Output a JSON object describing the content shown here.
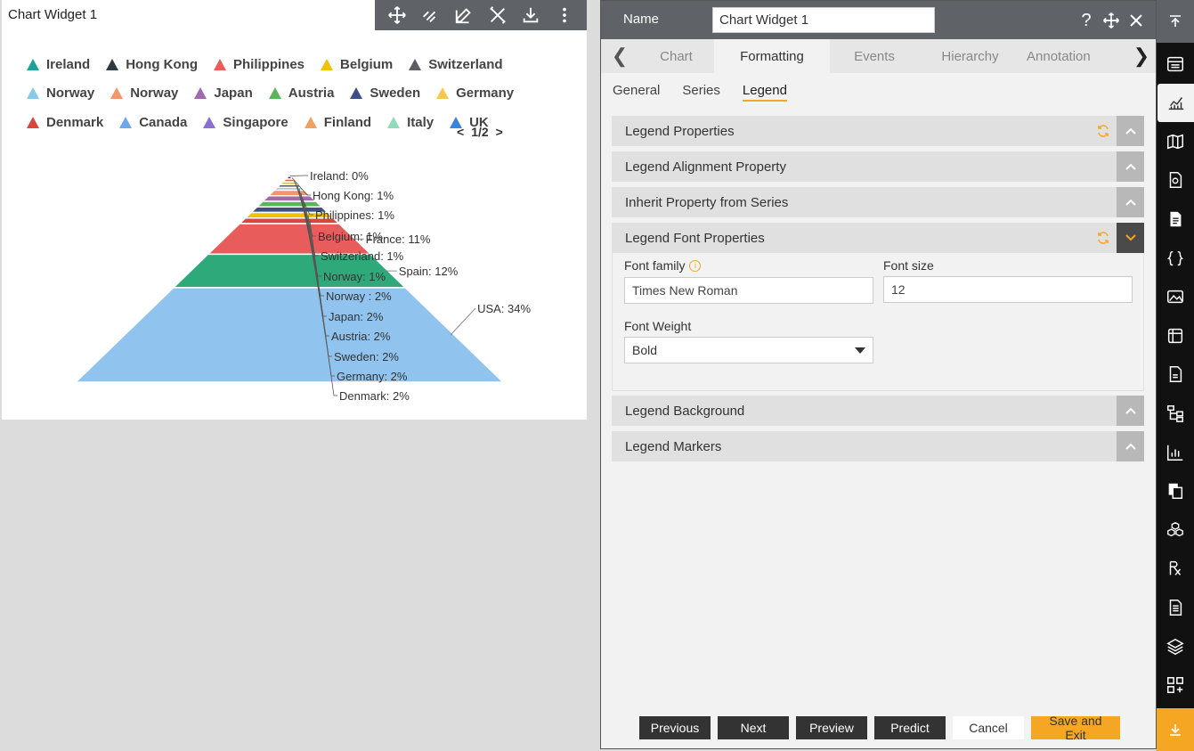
{
  "widget": {
    "title": "Chart Widget 1",
    "toolbar_icons": [
      "move-icon",
      "link-icon",
      "edit-icon",
      "tools-icon",
      "download-icon",
      "more-icon"
    ]
  },
  "chart_data": {
    "type": "pyramid",
    "legend": {
      "rows": [
        [
          {
            "name": "Ireland",
            "color": "#1aa39a"
          },
          {
            "name": "Hong Kong",
            "color": "#2f3a40"
          },
          {
            "name": "Philippines",
            "color": "#e85c5c"
          },
          {
            "name": "Belgium",
            "color": "#f2c200"
          },
          {
            "name": "Switzerland",
            "color": "#5a5e63"
          }
        ],
        [
          {
            "name": "Norway",
            "color": "#89c9e8"
          },
          {
            "name": "Norway",
            "color": "#f5956b"
          },
          {
            "name": "Japan",
            "color": "#a06aad"
          },
          {
            "name": "Austria",
            "color": "#5bb55b"
          },
          {
            "name": "Sweden",
            "color": "#3d4f8a"
          },
          {
            "name": "Germany",
            "color": "#f5c84b"
          }
        ],
        [
          {
            "name": "Denmark",
            "color": "#d9463e"
          },
          {
            "name": "Canada",
            "color": "#6fa8e8"
          },
          {
            "name": "Singapore",
            "color": "#8a6ed0"
          },
          {
            "name": "Finland",
            "color": "#f0a060"
          },
          {
            "name": "Italy",
            "color": "#8fdbbe"
          },
          {
            "name": "UK",
            "color": "#3a84d9"
          }
        ]
      ],
      "pager": "1/2",
      "pager_prev": "<",
      "pager_next": ">"
    },
    "slices": [
      {
        "label": "Ireland: 0%",
        "value": 0,
        "color": "#1aa39a"
      },
      {
        "label": "Hong Kong: 1%",
        "value": 1,
        "color": "#2f3a40"
      },
      {
        "label": "Philippines: 1%",
        "value": 1,
        "color": "#e85c5c"
      },
      {
        "label": "Belgium: 1%",
        "value": 1,
        "color": "#f2c200"
      },
      {
        "label": "Switzerland: 1%",
        "value": 1,
        "color": "#5a5e63"
      },
      {
        "label": "Norway: 1%",
        "value": 1,
        "color": "#89c9e8"
      },
      {
        "label": "Norway : 2%",
        "value": 2,
        "color": "#f5956b"
      },
      {
        "label": "Japan: 2%",
        "value": 2,
        "color": "#a06aad"
      },
      {
        "label": "Austria: 2%",
        "value": 2,
        "color": "#5bb55b"
      },
      {
        "label": "Sweden: 2%",
        "value": 2,
        "color": "#3d4f8a"
      },
      {
        "label": "Germany: 2%",
        "value": 2,
        "color": "#f2c200"
      },
      {
        "label": "Denmark: 2%",
        "value": 2,
        "color": "#d9463e"
      },
      {
        "label": "France: 11%",
        "value": 11,
        "color": "#e85c5c"
      },
      {
        "label": "Spain: 12%",
        "value": 12,
        "color": "#2eaa7a"
      },
      {
        "label": "USA: 34%",
        "value": 34,
        "color": "#90c4ee"
      }
    ]
  },
  "panel": {
    "name_label": "Name",
    "name_value": "Chart Widget 1",
    "header_icons": [
      "help-icon",
      "move-icon",
      "close-icon"
    ],
    "tabs": [
      "Chart",
      "Formatting",
      "Events",
      "Hierarchy",
      "Annotation"
    ],
    "active_tab": "Formatting",
    "subtabs": [
      "General",
      "Series",
      "Legend"
    ],
    "active_subtab": "Legend",
    "sections": {
      "legend_properties": "Legend Properties",
      "legend_alignment": "Legend Alignment Property",
      "inherit_property": "Inherit Property from Series",
      "legend_font": "Legend Font Properties",
      "legend_background": "Legend Background",
      "legend_markers": "Legend Markers"
    },
    "font": {
      "family_label": "Font family",
      "family_value": "Times New Roman",
      "size_label": "Font size",
      "size_value": "12",
      "weight_label": "Font Weight",
      "weight_value": "Bold"
    },
    "buttons": {
      "previous": "Previous",
      "next": "Next",
      "preview": "Preview",
      "predict": "Predict",
      "cancel": "Cancel",
      "save_exit": "Save and Exit"
    }
  },
  "colors": {
    "accent": "#f5a623",
    "header_bg": "#5f6368",
    "sidebar_bg": "#111111"
  },
  "sidebar_icons": [
    "collapse-top-icon",
    "table-icon",
    "chart-icon",
    "map-icon",
    "report-icon",
    "document-icon",
    "code-icon",
    "image-icon",
    "scheduler-icon",
    "file-icon",
    "hierarchy-icon",
    "bar-chart-icon",
    "copy-icon",
    "cubes-icon",
    "rx-icon",
    "notes-icon",
    "layers-icon",
    "add-widget-icon",
    "download-bottom-icon"
  ]
}
